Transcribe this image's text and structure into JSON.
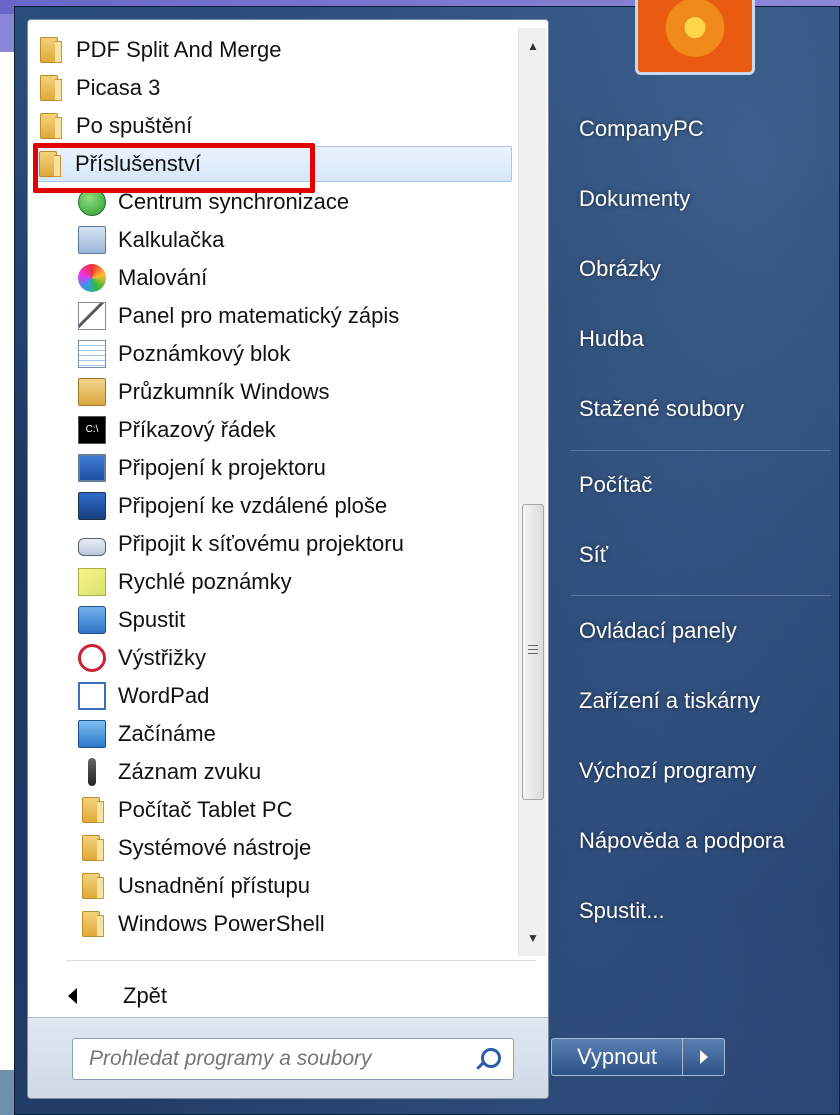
{
  "programs": {
    "top_folders": [
      {
        "label": "PDF Split And Merge",
        "icon": "folder-icon"
      },
      {
        "label": "Picasa 3",
        "icon": "folder-icon"
      },
      {
        "label": "Po spuštění",
        "icon": "folder-icon"
      },
      {
        "label": "Příslušenství",
        "icon": "folder-icon"
      }
    ],
    "accessories": [
      {
        "label": "Centrum synchronizace",
        "icon": "sync-center-icon"
      },
      {
        "label": "Kalkulačka",
        "icon": "calculator-icon"
      },
      {
        "label": "Malování",
        "icon": "paint-icon"
      },
      {
        "label": "Panel pro matematický zápis",
        "icon": "math-input-icon"
      },
      {
        "label": "Poznámkový blok",
        "icon": "notepad-icon"
      },
      {
        "label": "Průzkumník Windows",
        "icon": "explorer-icon"
      },
      {
        "label": "Příkazový řádek",
        "icon": "command-prompt-icon"
      },
      {
        "label": "Připojení k projektoru",
        "icon": "projector-icon"
      },
      {
        "label": "Připojení ke vzdálené ploše",
        "icon": "remote-desktop-icon"
      },
      {
        "label": "Připojit k síťovému projektoru",
        "icon": "network-projector-icon"
      },
      {
        "label": "Rychlé poznámky",
        "icon": "sticky-notes-icon"
      },
      {
        "label": "Spustit",
        "icon": "run-icon"
      },
      {
        "label": "Výstřižky",
        "icon": "snipping-tool-icon"
      },
      {
        "label": "WordPad",
        "icon": "wordpad-icon"
      },
      {
        "label": "Začínáme",
        "icon": "getting-started-icon"
      },
      {
        "label": "Záznam zvuku",
        "icon": "microphone-icon"
      },
      {
        "label": "Počítač Tablet PC",
        "icon": "folder-icon"
      },
      {
        "label": "Systémové nástroje",
        "icon": "folder-icon"
      },
      {
        "label": "Usnadnění přístupu",
        "icon": "folder-icon"
      },
      {
        "label": "Windows PowerShell",
        "icon": "folder-icon"
      }
    ],
    "back_label": "Zpět",
    "cmd_icon_text": "C:\\"
  },
  "search": {
    "placeholder": "Prohledat programy a soubory"
  },
  "right": {
    "items": [
      "CompanyPC",
      "Dokumenty",
      "Obrázky",
      "Hudba",
      "Stažené soubory",
      "Počítač",
      "Síť",
      "Ovládací panely",
      "Zařízení a tiskárny",
      "Výchozí programy",
      "Nápověda a podpora",
      "Spustit..."
    ]
  },
  "shutdown": {
    "label": "Vypnout"
  },
  "colors": {
    "highlight": "#e20000",
    "menu_background": "#1c3961",
    "selected_row": "#d6e7fa"
  }
}
